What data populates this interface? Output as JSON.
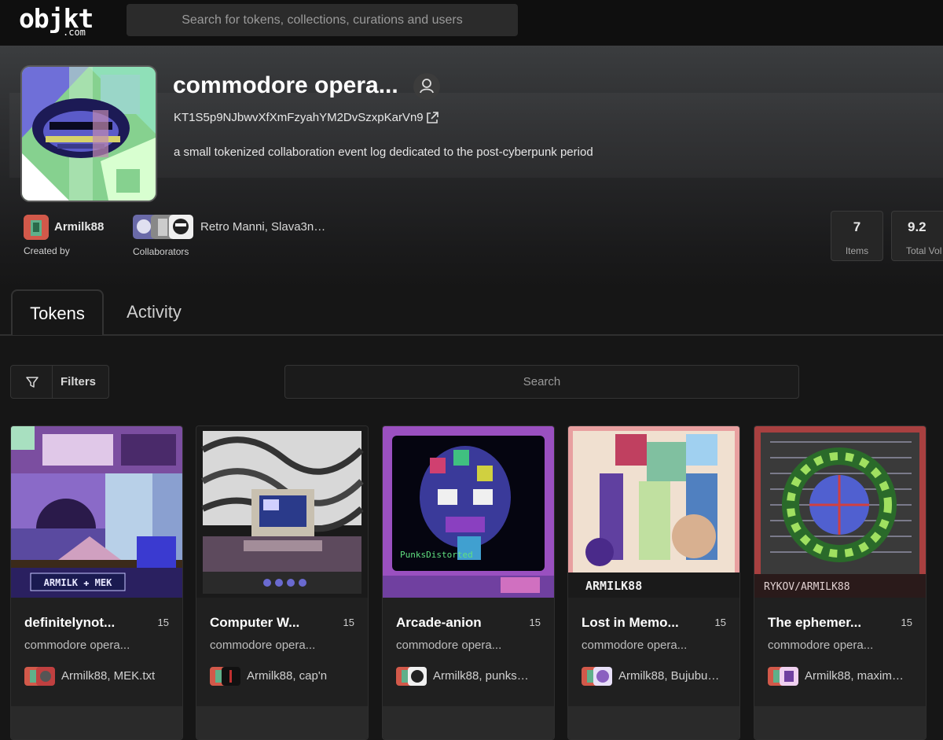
{
  "brand": {
    "logo_main": "objkt",
    "logo_sub": ".com"
  },
  "search": {
    "placeholder": "Search for tokens, collections, curations and users"
  },
  "collection": {
    "title": "commodore opera...",
    "address": "KT1S5p9NJbwvXfXmFzyahYM2DvSzxpKarVn9",
    "description": "a small tokenized collaboration event log dedicated to the post-cyberpunk period",
    "creator": {
      "name": "Armilk88",
      "label": "Created by"
    },
    "collaborators": {
      "names": "Retro Manni, Slava3n…",
      "label": "Collaborators"
    },
    "stats": [
      {
        "value": "7",
        "label": "Items"
      },
      {
        "value": "9.2",
        "label": "Total Vol"
      }
    ]
  },
  "tabs": [
    {
      "label": "Tokens"
    },
    {
      "label": "Activity"
    }
  ],
  "toolbar": {
    "filters_label": "Filters",
    "search_placeholder": "Search"
  },
  "tokens": [
    {
      "title": "definitelynot...",
      "editions": "15",
      "collection": "commodore opera...",
      "artists": "Armilk88, MEK.txt"
    },
    {
      "title": "Computer W...",
      "editions": "15",
      "collection": "commodore opera...",
      "artists": "Armilk88, cap'n"
    },
    {
      "title": "Arcade-anion",
      "editions": "15",
      "collection": "commodore opera...",
      "artists": "Armilk88, punks…"
    },
    {
      "title": "Lost in Memo...",
      "editions": "15",
      "collection": "commodore opera...",
      "artists": "Armilk88, Bujubu…"
    },
    {
      "title": "The ephemer...",
      "editions": "15",
      "collection": "commodore opera...",
      "artists": "Armilk88, maxim…"
    }
  ],
  "art_labels": {
    "card1": "ARMILK ✚ MEK",
    "card3": "PunksDistorted",
    "card4": "ARMILK88",
    "card5": "RYKOV/ARMILK88"
  },
  "colors": {
    "accent": "#d2594a",
    "background": "#161616",
    "card": "#1f1f1f"
  }
}
